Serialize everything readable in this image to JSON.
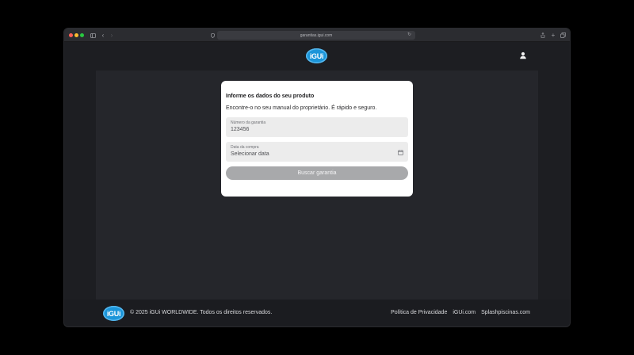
{
  "browser": {
    "url": "garantias.igui.com"
  },
  "brand": {
    "logo_text": "iGUi",
    "color": "#1b95d9"
  },
  "form": {
    "title": "Informe os dados do seu produto",
    "subtitle": "Encontre-o no seu manual do proprietário. É rápido e seguro.",
    "warranty_label": "Número da garantia",
    "warranty_value": "123456",
    "date_label": "Data da compra",
    "date_placeholder": "Selecionar data",
    "submit_label": "Buscar garantia"
  },
  "footer": {
    "copyright": "© 2025 iGUi WORLDWIDE. Todos os direitos reservados.",
    "links": [
      "Política de Privacidade",
      "iGUi.com",
      "Splashpiscinas.com"
    ]
  }
}
